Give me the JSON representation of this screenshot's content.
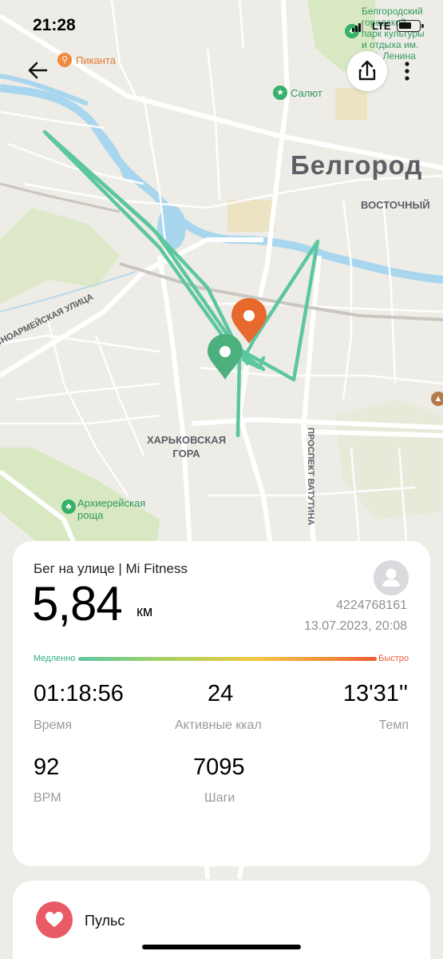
{
  "status_bar": {
    "time": "21:28",
    "network": "LTE"
  },
  "map": {
    "city_label": "Белгород",
    "district_east": "ВОСТОЧНЫЙ",
    "district_kharkov": "ХАРЬКОВСКАЯ\nГОРА",
    "street_krasnoarm": "СНОАРМЕЙСКАЯ УЛИЦА",
    "street_vatutina": "ПРОСПЕКТ ВАТУТИНА",
    "poi_piканта": "Пиканта",
    "poi_salut": "Салют",
    "poi_park": "Белгородский\nгородской\nпарк культуры\nи отдыха им.\nВ.И. Ленина",
    "poi_grove": "Архиерейская\nроща",
    "route_color": "#5cc79f",
    "start_marker_color": "#e8692d",
    "end_marker_color": "#4bb07b"
  },
  "workout": {
    "title": "Бег на улице | Mi Fitness",
    "distance": "5,84",
    "distance_unit": "км",
    "user_id": "4224768161",
    "datetime": "13.07.2023, 20:08",
    "pace_slow_label": "Медленно",
    "pace_fast_label": "Быстро",
    "stats": [
      {
        "value": "01:18:56",
        "label": "Время"
      },
      {
        "value": "24",
        "label": "Активные ккал"
      },
      {
        "value": "13'31''",
        "label": "Темп"
      },
      {
        "value": "92",
        "label": "BPM"
      },
      {
        "value": "7095",
        "label": "Шаги"
      }
    ]
  },
  "pulse_section": {
    "label": "Пульс"
  },
  "icons": {
    "back": "back-arrow-icon",
    "share": "share-icon",
    "more": "more-vertical-icon",
    "avatar": "user-avatar-icon",
    "heart": "heart-icon"
  }
}
